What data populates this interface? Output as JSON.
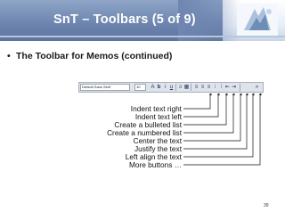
{
  "slide": {
    "title": "SnT – Toolbars (5 of 9)",
    "bullet": "The Toolbar for Memos (continued)",
    "bullet_marker": "•",
    "page_number": "39"
  },
  "toolbar": {
    "font_name": "Default Sans Serif",
    "font_size": "10",
    "buttons": [
      {
        "name": "text-size-icon",
        "glyph": "A"
      },
      {
        "name": "bold-icon",
        "glyph": "b"
      },
      {
        "name": "italic-icon",
        "glyph": "i"
      },
      {
        "name": "underline-icon",
        "glyph": "u"
      },
      {
        "name": "text-color-icon",
        "glyph": "ↄ"
      },
      {
        "name": "highlight-icon",
        "glyph": "▦"
      },
      {
        "name": "left-align-icon",
        "glyph": "≡"
      },
      {
        "name": "justify-icon",
        "glyph": "≡"
      },
      {
        "name": "center-icon",
        "glyph": "≡"
      },
      {
        "name": "numbered-list-icon",
        "glyph": "⁝"
      },
      {
        "name": "bulleted-list-icon",
        "glyph": "⁞"
      },
      {
        "name": "indent-left-icon",
        "glyph": "⇤"
      },
      {
        "name": "indent-right-icon",
        "glyph": "⇥"
      },
      {
        "name": "more-buttons-icon",
        "glyph": "»"
      }
    ]
  },
  "callouts": [
    "Indent text right",
    "Indent text left",
    "Create a bulleted list",
    "Create a numbered list",
    "Center the text",
    "Justify the text",
    "Left align the text",
    "More buttons …"
  ],
  "colors": {
    "title_text": "#ffffff",
    "header_band": "#6f86b0",
    "body_text": "#111111",
    "toolbar_bg": "#dfe3ea"
  }
}
